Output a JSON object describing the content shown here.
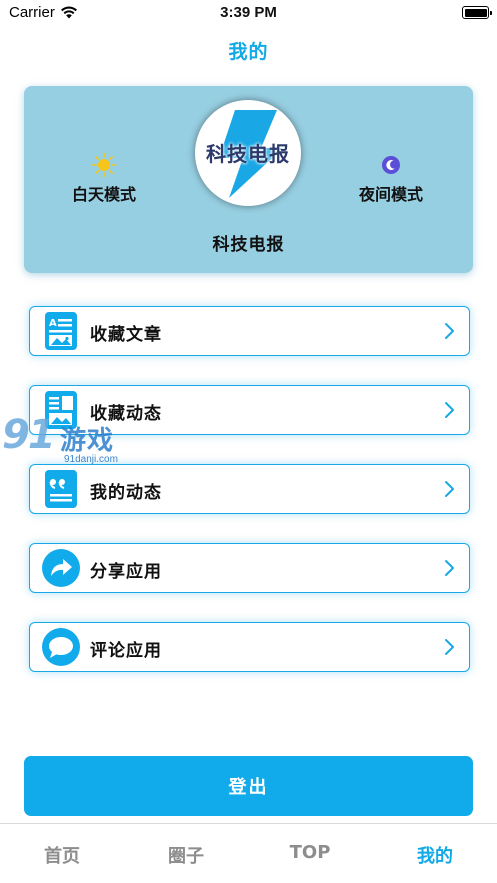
{
  "status_bar": {
    "carrier": "Carrier",
    "time": "3:39 PM",
    "battery_level": 1.0
  },
  "header": {
    "title": "我的"
  },
  "profile": {
    "logo_text": "科技电报",
    "username": "科技电报",
    "day_mode_label": "白天模式",
    "night_mode_label": "夜间模式",
    "day_icon": "sun-icon",
    "night_icon": "moon-icon"
  },
  "menu": {
    "items": [
      {
        "label": "收藏文章",
        "icon": "article-icon"
      },
      {
        "label": "收藏动态",
        "icon": "feed-icon"
      },
      {
        "label": "我的动态",
        "icon": "quote-icon"
      },
      {
        "label": "分享应用",
        "icon": "share-icon"
      },
      {
        "label": "评论应用",
        "icon": "comment-icon"
      }
    ]
  },
  "logout": {
    "label": "登出"
  },
  "tab_bar": {
    "tabs": [
      "首页",
      "圈子",
      "TOP",
      "我的"
    ],
    "active_index": 3
  },
  "watermark": {
    "number": "91",
    "text": "游戏",
    "url": "91danji.com"
  },
  "colors": {
    "accent": "#13a9e6",
    "card_bg": "#97cfe2",
    "button_bg": "#11aaeb",
    "tab_inactive": "#8d8d8d"
  }
}
